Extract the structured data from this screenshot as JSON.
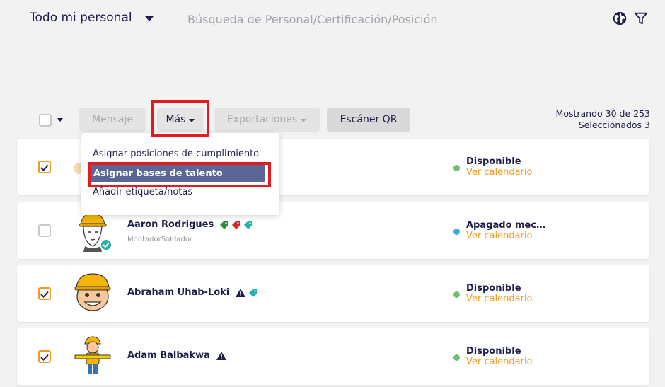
{
  "header": {
    "scope_label": "Todo mi personal",
    "search_placeholder": "Búsqueda de Personal/Certificación/Posición"
  },
  "toolbar": {
    "message_label": "Mensaje",
    "more_label": "Más",
    "exports_label": "Exportaciones",
    "qr_label": "Escáner QR",
    "showing_text": "Mostrando 30 de 253",
    "selected_text": "Seleccionados 3"
  },
  "dropdown": {
    "items": [
      "Asignar posiciones de cumplimiento",
      "Asignar bases de talento",
      "Añadir etiqueta/notas"
    ],
    "active_index": 1
  },
  "rows": [
    {
      "name": "",
      "role": "",
      "checked": true,
      "status": "Disponible",
      "status_color": "#6cc070",
      "calendar": "Ver calendario",
      "tags": []
    },
    {
      "name": "Aaron Rodrigues",
      "role": "MontadorSoldador",
      "checked": false,
      "status": "Apagado mec…",
      "status_color": "#3fa8e0",
      "calendar": "Ver calendario",
      "tags": [
        "green-tag-icon",
        "red-tag-icon",
        "teal-tag-icon"
      ],
      "verified": true
    },
    {
      "name": "Abraham Uhab-Loki",
      "role": "",
      "checked": true,
      "status": "Disponible",
      "status_color": "#6cc070",
      "calendar": "Ver calendario",
      "tags": [
        "warning-icon",
        "teal-tag-icon"
      ]
    },
    {
      "name": "Adam Balbakwa",
      "role": "",
      "checked": true,
      "status": "Disponible",
      "status_color": "#6cc070",
      "calendar": "Ver calendario",
      "tags": [
        "warning-icon"
      ]
    }
  ],
  "colors": {
    "accent_orange": "#f29a1f",
    "navy": "#1d1f4a",
    "highlight_red": "#e21b23",
    "menu_active": "#5a6796"
  }
}
